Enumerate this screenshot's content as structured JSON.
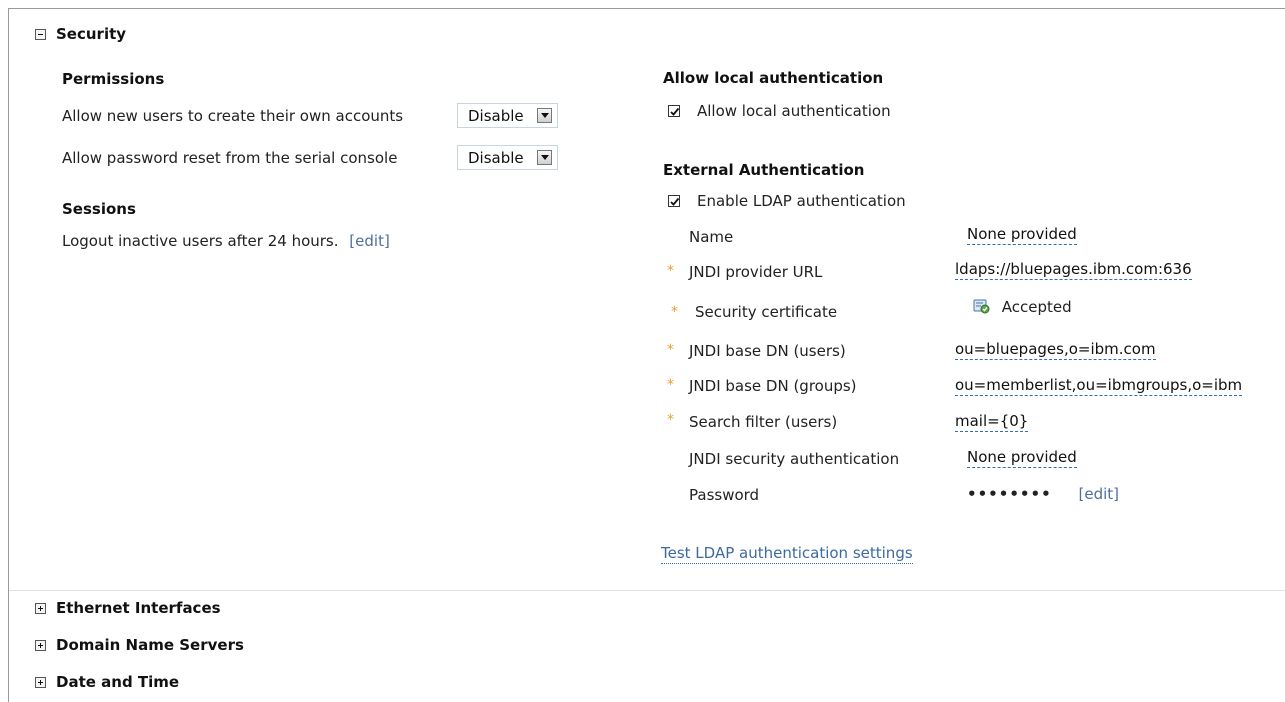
{
  "security": {
    "title": "Security",
    "permissions": {
      "heading": "Permissions",
      "rows": [
        {
          "label": "Allow new users to create their own accounts",
          "value": "Disable"
        },
        {
          "label": "Allow password reset from the serial console",
          "value": "Disable"
        }
      ]
    },
    "sessions": {
      "heading": "Sessions",
      "text": "Logout inactive users after 24 hours.",
      "edit_label": "[edit]"
    },
    "local_auth": {
      "heading": "Allow local authentication",
      "checkbox_label": "Allow local authentication",
      "checked": true
    },
    "external_auth": {
      "heading": "External Authentication",
      "checkbox_label": "Enable LDAP authentication",
      "checked": true,
      "required_marker": "*",
      "fields": {
        "name": {
          "label": "Name",
          "value": "None provided"
        },
        "jndi_url": {
          "label": "JNDI provider URL",
          "value": "ldaps://bluepages.ibm.com:636"
        },
        "cert": {
          "label": "Security certificate",
          "value": "Accepted"
        },
        "base_dn_users": {
          "label": "JNDI base DN (users)",
          "value": "ou=bluepages,o=ibm.com"
        },
        "base_dn_groups": {
          "label": "JNDI base DN (groups)",
          "value": "ou=memberlist,ou=ibmgroups,o=ibm"
        },
        "search_filter": {
          "label": "Search filter (users)",
          "value": "mail={0}"
        },
        "security_auth": {
          "label": "JNDI security authentication",
          "value": "None provided"
        },
        "password": {
          "label": "Password",
          "value": "••••••••",
          "edit_label": "[edit]"
        }
      },
      "test_link": "Test LDAP authentication settings"
    }
  },
  "collapsed_sections": [
    {
      "title": "Ethernet Interfaces"
    },
    {
      "title": "Domain Name Servers"
    },
    {
      "title": "Date and Time"
    }
  ],
  "colors": {
    "link": "#4e6f9c",
    "required_star": "#e8a030",
    "dashed_underline": "#2f6db5"
  }
}
